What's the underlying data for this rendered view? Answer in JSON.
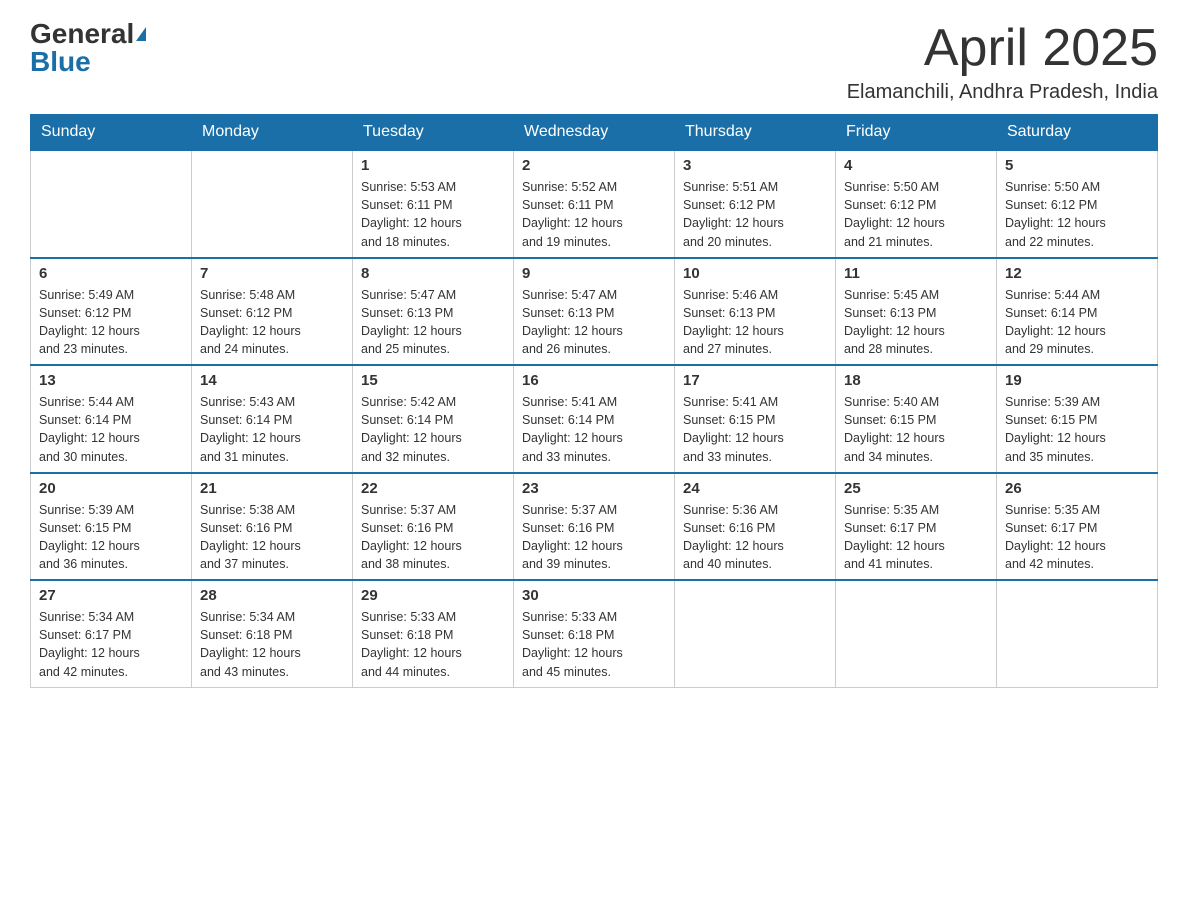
{
  "header": {
    "logo_general": "General",
    "logo_blue": "Blue",
    "month_title": "April 2025",
    "location": "Elamanchili, Andhra Pradesh, India"
  },
  "weekdays": [
    "Sunday",
    "Monday",
    "Tuesday",
    "Wednesday",
    "Thursday",
    "Friday",
    "Saturday"
  ],
  "weeks": [
    [
      {
        "day": "",
        "info": ""
      },
      {
        "day": "",
        "info": ""
      },
      {
        "day": "1",
        "info": "Sunrise: 5:53 AM\nSunset: 6:11 PM\nDaylight: 12 hours\nand 18 minutes."
      },
      {
        "day": "2",
        "info": "Sunrise: 5:52 AM\nSunset: 6:11 PM\nDaylight: 12 hours\nand 19 minutes."
      },
      {
        "day": "3",
        "info": "Sunrise: 5:51 AM\nSunset: 6:12 PM\nDaylight: 12 hours\nand 20 minutes."
      },
      {
        "day": "4",
        "info": "Sunrise: 5:50 AM\nSunset: 6:12 PM\nDaylight: 12 hours\nand 21 minutes."
      },
      {
        "day": "5",
        "info": "Sunrise: 5:50 AM\nSunset: 6:12 PM\nDaylight: 12 hours\nand 22 minutes."
      }
    ],
    [
      {
        "day": "6",
        "info": "Sunrise: 5:49 AM\nSunset: 6:12 PM\nDaylight: 12 hours\nand 23 minutes."
      },
      {
        "day": "7",
        "info": "Sunrise: 5:48 AM\nSunset: 6:12 PM\nDaylight: 12 hours\nand 24 minutes."
      },
      {
        "day": "8",
        "info": "Sunrise: 5:47 AM\nSunset: 6:13 PM\nDaylight: 12 hours\nand 25 minutes."
      },
      {
        "day": "9",
        "info": "Sunrise: 5:47 AM\nSunset: 6:13 PM\nDaylight: 12 hours\nand 26 minutes."
      },
      {
        "day": "10",
        "info": "Sunrise: 5:46 AM\nSunset: 6:13 PM\nDaylight: 12 hours\nand 27 minutes."
      },
      {
        "day": "11",
        "info": "Sunrise: 5:45 AM\nSunset: 6:13 PM\nDaylight: 12 hours\nand 28 minutes."
      },
      {
        "day": "12",
        "info": "Sunrise: 5:44 AM\nSunset: 6:14 PM\nDaylight: 12 hours\nand 29 minutes."
      }
    ],
    [
      {
        "day": "13",
        "info": "Sunrise: 5:44 AM\nSunset: 6:14 PM\nDaylight: 12 hours\nand 30 minutes."
      },
      {
        "day": "14",
        "info": "Sunrise: 5:43 AM\nSunset: 6:14 PM\nDaylight: 12 hours\nand 31 minutes."
      },
      {
        "day": "15",
        "info": "Sunrise: 5:42 AM\nSunset: 6:14 PM\nDaylight: 12 hours\nand 32 minutes."
      },
      {
        "day": "16",
        "info": "Sunrise: 5:41 AM\nSunset: 6:14 PM\nDaylight: 12 hours\nand 33 minutes."
      },
      {
        "day": "17",
        "info": "Sunrise: 5:41 AM\nSunset: 6:15 PM\nDaylight: 12 hours\nand 33 minutes."
      },
      {
        "day": "18",
        "info": "Sunrise: 5:40 AM\nSunset: 6:15 PM\nDaylight: 12 hours\nand 34 minutes."
      },
      {
        "day": "19",
        "info": "Sunrise: 5:39 AM\nSunset: 6:15 PM\nDaylight: 12 hours\nand 35 minutes."
      }
    ],
    [
      {
        "day": "20",
        "info": "Sunrise: 5:39 AM\nSunset: 6:15 PM\nDaylight: 12 hours\nand 36 minutes."
      },
      {
        "day": "21",
        "info": "Sunrise: 5:38 AM\nSunset: 6:16 PM\nDaylight: 12 hours\nand 37 minutes."
      },
      {
        "day": "22",
        "info": "Sunrise: 5:37 AM\nSunset: 6:16 PM\nDaylight: 12 hours\nand 38 minutes."
      },
      {
        "day": "23",
        "info": "Sunrise: 5:37 AM\nSunset: 6:16 PM\nDaylight: 12 hours\nand 39 minutes."
      },
      {
        "day": "24",
        "info": "Sunrise: 5:36 AM\nSunset: 6:16 PM\nDaylight: 12 hours\nand 40 minutes."
      },
      {
        "day": "25",
        "info": "Sunrise: 5:35 AM\nSunset: 6:17 PM\nDaylight: 12 hours\nand 41 minutes."
      },
      {
        "day": "26",
        "info": "Sunrise: 5:35 AM\nSunset: 6:17 PM\nDaylight: 12 hours\nand 42 minutes."
      }
    ],
    [
      {
        "day": "27",
        "info": "Sunrise: 5:34 AM\nSunset: 6:17 PM\nDaylight: 12 hours\nand 42 minutes."
      },
      {
        "day": "28",
        "info": "Sunrise: 5:34 AM\nSunset: 6:18 PM\nDaylight: 12 hours\nand 43 minutes."
      },
      {
        "day": "29",
        "info": "Sunrise: 5:33 AM\nSunset: 6:18 PM\nDaylight: 12 hours\nand 44 minutes."
      },
      {
        "day": "30",
        "info": "Sunrise: 5:33 AM\nSunset: 6:18 PM\nDaylight: 12 hours\nand 45 minutes."
      },
      {
        "day": "",
        "info": ""
      },
      {
        "day": "",
        "info": ""
      },
      {
        "day": "",
        "info": ""
      }
    ]
  ]
}
